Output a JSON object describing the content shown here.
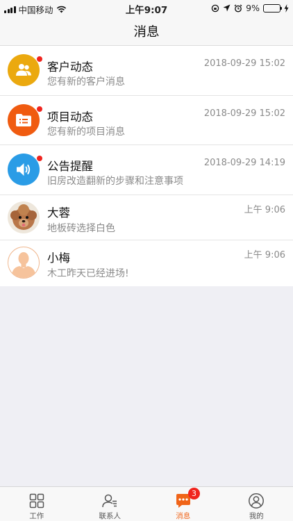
{
  "status_bar": {
    "carrier": "中国移动",
    "time": "上午9:07",
    "battery_percent": "9%",
    "battery_level": 0.09
  },
  "header": {
    "title": "消息"
  },
  "messages": [
    {
      "name": "客户动态",
      "preview": "您有新的客户消息",
      "time": "2018-09-29 15:02",
      "icon": "customers-icon",
      "color": "#eba90f",
      "unread": true
    },
    {
      "name": "项目动态",
      "preview": "您有新的项目消息",
      "time": "2018-09-29 15:02",
      "icon": "folder-list-icon",
      "color": "#f05b10",
      "unread": true
    },
    {
      "name": "公告提醒",
      "preview": "旧房改造翻新的步骤和注意事项",
      "time": "2018-09-29 14:19",
      "icon": "speaker-icon",
      "color": "#2a9ce6",
      "unread": true
    },
    {
      "name": "大蓉",
      "preview": "地板砖选择白色",
      "time": "上午 9:06",
      "icon": "dog-avatar",
      "unread": false
    },
    {
      "name": "小梅",
      "preview": "木工昨天已经进场!",
      "time": "上午 9:06",
      "icon": "default-person-avatar",
      "unread": false
    }
  ],
  "tabs": [
    {
      "label": "工作",
      "icon": "grid-icon",
      "active": false
    },
    {
      "label": "联系人",
      "icon": "contacts-icon",
      "active": false
    },
    {
      "label": "消息",
      "icon": "chat-icon",
      "active": true,
      "badge": "3"
    },
    {
      "label": "我的",
      "icon": "profile-icon",
      "active": false
    }
  ],
  "colors": {
    "accent": "#f06418",
    "badge": "#f0241e",
    "unread_dot": "#f0241e"
  }
}
